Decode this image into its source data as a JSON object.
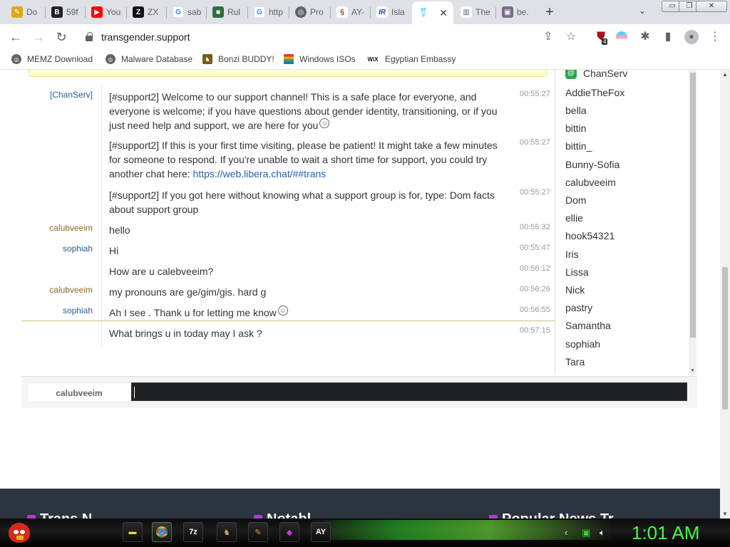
{
  "tabs": [
    {
      "title": "Do",
      "icon": "pencil-icon",
      "color": "#e0a818"
    },
    {
      "title": "59f",
      "icon": "b-logo-icon",
      "color": "#222222"
    },
    {
      "title": "You",
      "icon": "youtube-icon",
      "color": "#ff0000"
    },
    {
      "title": "ZX",
      "icon": "zx-icon",
      "color": "#111111"
    },
    {
      "title": "sab",
      "icon": "google-icon",
      "color": "#4285f4"
    },
    {
      "title": "Rul",
      "icon": "green-square-icon",
      "color": "#2f6e3a"
    },
    {
      "title": "http",
      "icon": "google-icon",
      "color": "#4285f4"
    },
    {
      "title": "Pro",
      "icon": "globe-icon",
      "color": "#5f6368"
    },
    {
      "title": "AY-",
      "icon": "swirl-icon",
      "color": "#b5332a"
    },
    {
      "title": "Isla",
      "icon": "ir-logo-icon",
      "color": "#1a4aa8"
    },
    {
      "title": "",
      "icon": "trans-support-icon",
      "color": "#5bcefa"
    },
    {
      "title": "The",
      "icon": "chart-icon",
      "color": "#5f6368"
    },
    {
      "title": "be.",
      "icon": "photo-icon",
      "color": "#7a6a8a"
    }
  ],
  "window_controls": {
    "minimize": "▭",
    "restore": "❐",
    "close": "✕"
  },
  "address_bar": {
    "url": "transgender.support"
  },
  "extension_badge": "4",
  "bookmarks": [
    {
      "label": "MEMZ Download",
      "icon": "globe-icon"
    },
    {
      "label": "Malware Database",
      "icon": "globe-icon"
    },
    {
      "label": "Bonzi BUDDY!",
      "icon": "bonzi-icon"
    },
    {
      "label": "Windows ISOs",
      "icon": "windows-icon"
    },
    {
      "label": "Egyptian Embassy",
      "icon": "wix-icon"
    }
  ],
  "chat": {
    "messages": [
      {
        "nick": "[ChanServ]",
        "text": "[#support2] Welcome to our support channel! This is a safe place for everyone, and everyone is welcome; if you have questions about gender identity, transitioning, or if you just need help and support, we are here for you",
        "smiley": true,
        "time": "00:55:27"
      },
      {
        "nick": "",
        "text_before_link": "[#support2] If this is your first time visiting, please be patient! It might take a few minutes for someone to respond. If you're unable to wait a short time for support, you could try another chat here: ",
        "link": "https://web.libera.chat/##trans",
        "time": "00:55:27"
      },
      {
        "nick": "",
        "text": "[#support2] If you got here without knowing what a support group is for, type: Dom facts about support group",
        "time": "00:55:27"
      },
      {
        "nick": "calubveeim",
        "text": "hello",
        "time": "00:55:32"
      },
      {
        "nick": "sophiah",
        "text": "Hi",
        "time": "00:55:47"
      },
      {
        "nick": "",
        "text": "How are u calebveeim?",
        "time": "00:56:12"
      },
      {
        "nick": "calubveeim",
        "text": "my pronouns are ge/gim/gis. hard g",
        "time": "00:56:26"
      },
      {
        "nick": "sophiah",
        "text": "Ah I see . Thank u for letting me know",
        "smiley": true,
        "time": "00:56:55"
      },
      {
        "nick": "",
        "text": "What brings u in today may I ask ?",
        "time": "00:57:15"
      }
    ],
    "smiley_glyph": "☺",
    "input_nick": "calubveeim",
    "input_value": ""
  },
  "userlist": [
    "ChanServ",
    "AddieTheFox",
    "bella",
    "bittin",
    "bittin_",
    "Bunny-Sofia",
    "calubveeim",
    "Dom",
    "ellie",
    "hook54321",
    "Iris",
    "Lissa",
    "Nick",
    "pastry",
    "Samantha",
    "sophiah",
    "Tara"
  ],
  "footer": {
    "headings": [
      "Trans N",
      "Notabl",
      "Popular News Tr"
    ]
  },
  "taskbar": {
    "apps": [
      {
        "icon": "folder-icon",
        "label": ""
      },
      {
        "icon": "chrome-icon",
        "label": ""
      },
      {
        "icon": "7zip-icon",
        "label": "7z"
      },
      {
        "icon": "bonzi-icon",
        "label": ""
      },
      {
        "icon": "pencil-icon",
        "label": ""
      },
      {
        "icon": "purple-fish-icon",
        "label": ""
      },
      {
        "icon": "ay-icon",
        "label": "AY"
      }
    ],
    "clock": "1:01 AM"
  }
}
